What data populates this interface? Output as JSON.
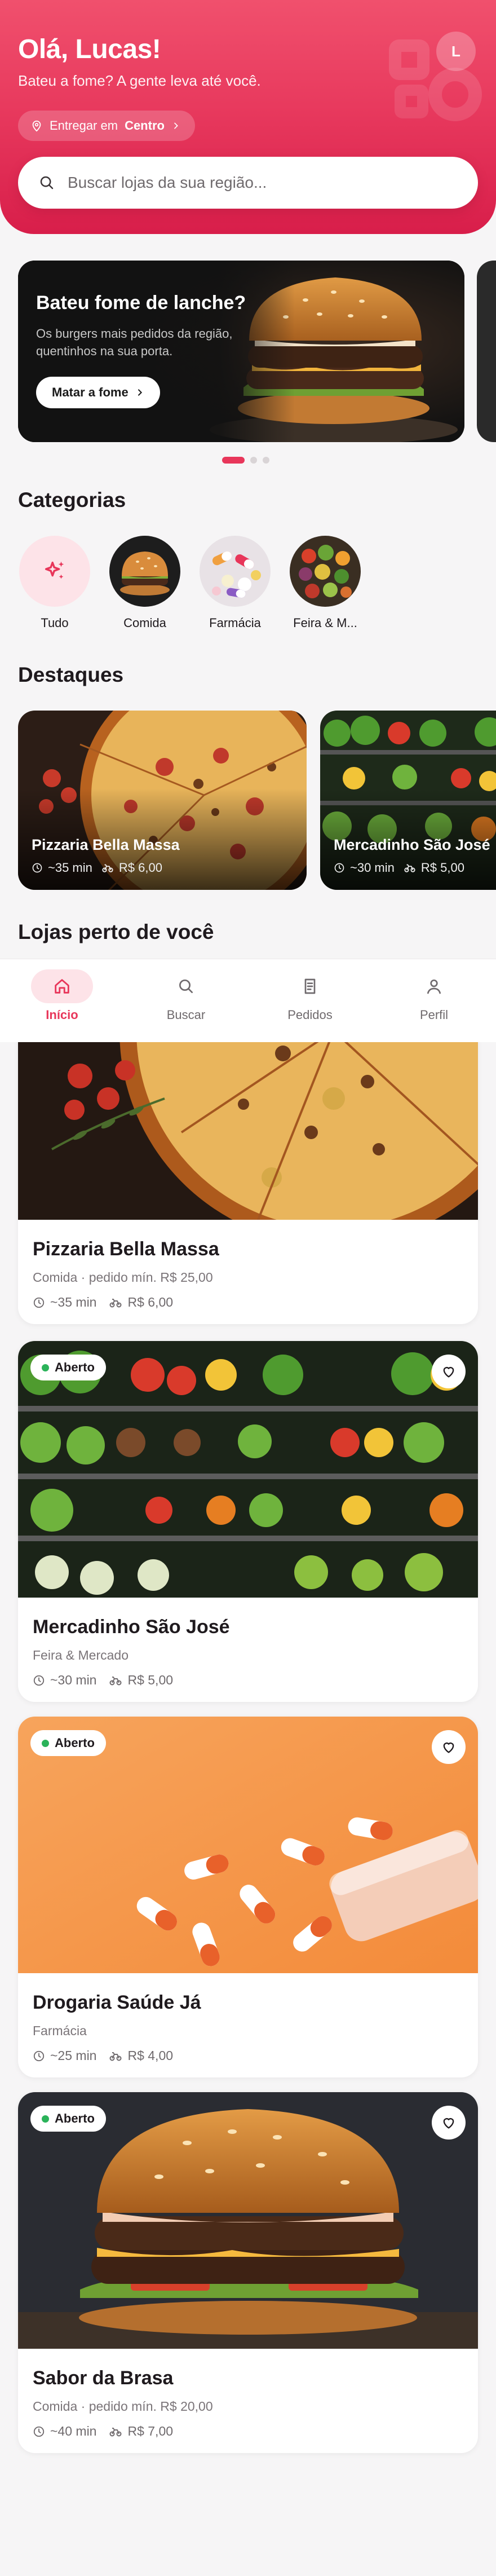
{
  "header": {
    "greeting": "Olá, Lucas!",
    "subtitle": "Bateu a fome? A gente leva até você.",
    "avatar_initial": "L",
    "deliver_prefix": "Entregar em",
    "deliver_location": "Centro"
  },
  "search": {
    "placeholder": "Buscar lojas da sua região..."
  },
  "banner": {
    "title": "Bateu fome de lanche?",
    "text": "Os burgers mais pedidos da região, quentinhos na sua porta.",
    "button": "Matar a fome",
    "pages": 3,
    "active_page": 1
  },
  "categories": {
    "title": "Categorias",
    "items": [
      {
        "label": "Tudo",
        "selected": true
      },
      {
        "label": "Comida",
        "selected": false
      },
      {
        "label": "Farmácia",
        "selected": false
      },
      {
        "label": "Feira & M...",
        "selected": false
      }
    ]
  },
  "highlights": {
    "title": "Destaques",
    "items": [
      {
        "name": "Pizzaria Bella Massa",
        "time": "~35 min",
        "fee": "R$ 6,00"
      },
      {
        "name": "Mercadinho São José",
        "time": "~30 min",
        "fee": "R$ 5,00"
      }
    ]
  },
  "nearby": {
    "title": "Lojas perto de você",
    "stores": [
      {
        "name": "Pizzaria Bella Massa",
        "category": "Comida · pedido mín. R$ 25,00",
        "time": "~35 min",
        "fee": "R$ 6,00",
        "status": ""
      },
      {
        "name": "Mercadinho São José",
        "category": "Feira & Mercado",
        "time": "~30 min",
        "fee": "R$ 5,00",
        "status": "Aberto"
      },
      {
        "name": "Drogaria Saúde Já",
        "category": "Farmácia",
        "time": "~25 min",
        "fee": "R$ 4,00",
        "status": "Aberto"
      },
      {
        "name": "Sabor da Brasa",
        "category": "Comida · pedido mín. R$ 20,00",
        "time": "~40 min",
        "fee": "R$ 7,00",
        "status": "Aberto"
      }
    ]
  },
  "nav": {
    "items": [
      {
        "label": "Início",
        "icon": "home-icon",
        "active": true
      },
      {
        "label": "Buscar",
        "icon": "search-icon",
        "active": false
      },
      {
        "label": "Pedidos",
        "icon": "receipt-icon",
        "active": false
      },
      {
        "label": "Perfil",
        "icon": "user-icon",
        "active": false
      }
    ]
  },
  "colors": {
    "brand": "#e8365a",
    "open": "#2bb35a"
  }
}
